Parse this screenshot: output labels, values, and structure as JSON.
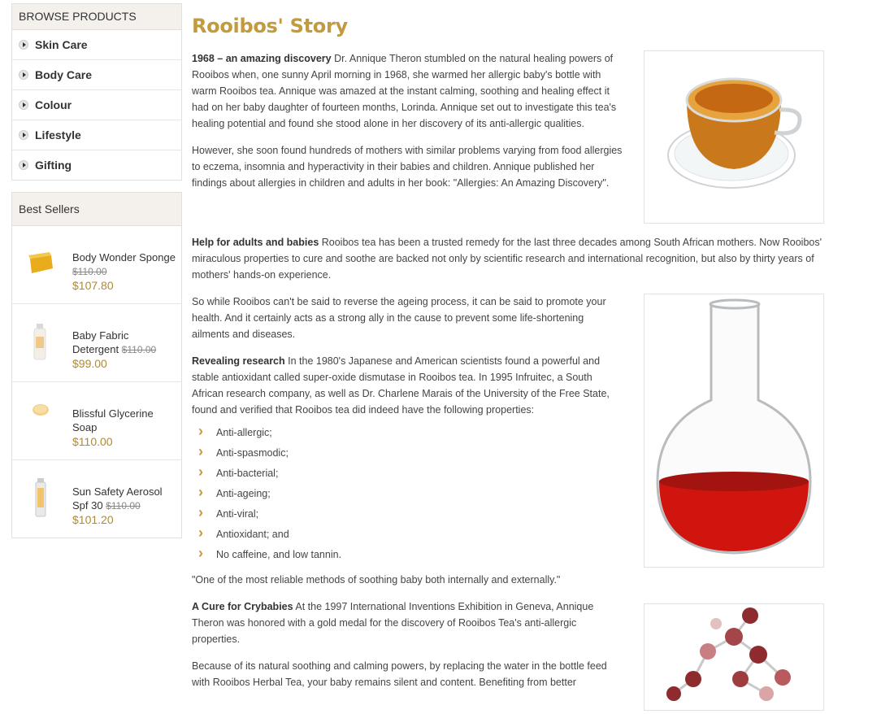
{
  "sidebar": {
    "browse_title": "BROWSE PRODUCTS",
    "categories": [
      {
        "label": "Skin Care"
      },
      {
        "label": "Body Care"
      },
      {
        "label": "Colour"
      },
      {
        "label": "Lifestyle"
      },
      {
        "label": "Gifting"
      }
    ],
    "bestsellers_title": "Best Sellers",
    "bestsellers": [
      {
        "name": "Body Wonder Sponge",
        "old_price": "$110.00",
        "price": "$107.80"
      },
      {
        "name": "Baby Fabric Detergent",
        "old_price": "$110.00",
        "price": "$99.00"
      },
      {
        "name": "Blissful Glycerine Soap",
        "old_price": "",
        "price": "$110.00"
      },
      {
        "name": "Sun Safety Aerosol Spf 30",
        "old_price": "$110.00",
        "price": "$101.20"
      }
    ]
  },
  "main": {
    "title": "Rooibos' Story",
    "p1_bold": "1968 – an amazing discovery",
    "p1": " Dr. Annique Theron stumbled on the natural healing powers of Rooibos when, one sunny April morning in 1968, she warmed her allergic baby's bottle with warm Rooibos tea. Annique was amazed at the instant calming, soothing and healing effect it had on her baby daughter of fourteen months, Lorinda. Annique set out to investigate this tea's healing potential and found she stood alone in her discovery of its anti-allergic qualities.",
    "p2": "However, she soon found hundreds of mothers with similar problems varying from food allergies to eczema, insomnia and hyperactivity in their babies and children. Annique published her findings about allergies in children and adults in her book: \"Allergies: An Amazing Discovery\".",
    "p3_bold": "Help for adults and babies",
    "p3": " Rooibos tea has been a trusted remedy for the last three decades among South African mothers. Now Rooibos' miraculous properties to cure and soothe are backed not only by scientific research and international recognition, but also by thirty years of mothers' hands-on experience.",
    "p4": "So while Rooibos can't be said to reverse the ageing process, it can be said to promote your health. And it certainly acts as a strong ally in the cause to prevent some life-shortening ailments and diseases.",
    "p5_bold": "Revealing research",
    "p5": " In the 1980's Japanese and American scientists found a powerful and stable antioxidant called super-oxide dismutase in Rooibos tea. In 1995 Infruitec, a South African research company, as well as Dr. Charlene Marais of the University of the Free State, found and verified that Rooibos tea did indeed have the following properties:",
    "properties": [
      "Anti-allergic;",
      "Anti-spasmodic;",
      "Anti-bacterial;",
      "Anti-ageing;",
      "Anti-viral;",
      "Antioxidant; and",
      "No caffeine, and low tannin."
    ],
    "quote": "\"One of the most reliable methods of soothing baby both internally and externally.\"",
    "p6_bold": "A Cure for Crybabies",
    "p6": " At the 1997 International Inventions Exhibition in Geneva, Annique Theron was honored with a gold medal for the discovery of Rooibos Tea's anti-allergic properties.",
    "p7": "Because of its natural soothing and calming powers, by replacing the water in the bottle feed with Rooibos Herbal Tea, your baby remains silent and content. Benefiting from better"
  }
}
